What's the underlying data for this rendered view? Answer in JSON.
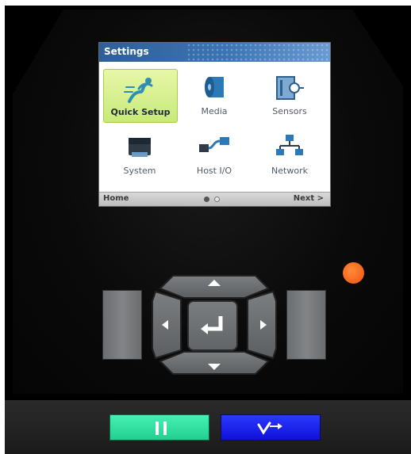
{
  "screen": {
    "title": "Settings",
    "header_color": "#3b74b4",
    "tiles": [
      {
        "label": "Quick Setup",
        "icon": "quick-setup-icon",
        "selected": true
      },
      {
        "label": "Media",
        "icon": "media-roll-icon",
        "selected": false
      },
      {
        "label": "Sensors",
        "icon": "sensors-icon",
        "selected": false
      },
      {
        "label": "System",
        "icon": "printer-icon",
        "selected": false
      },
      {
        "label": "Host I/O",
        "icon": "host-io-cable-icon",
        "selected": false
      },
      {
        "label": "Network",
        "icon": "network-icon",
        "selected": false
      }
    ],
    "footer": {
      "home_label": "Home",
      "next_label": "Next >",
      "page_current": 1,
      "page_total": 2
    }
  },
  "indicators": {
    "status_led_color": "#f0520b"
  },
  "keypad": {
    "up_icon": "arrow-up-icon",
    "down_icon": "arrow-down-icon",
    "left_icon": "arrow-left-icon",
    "right_icon": "arrow-right-icon",
    "ok_icon": "enter-icon"
  },
  "buttons": {
    "pause_icon": "pause-icon",
    "pause_color": "#20d08f",
    "feed_icon": "feed-icon",
    "feed_color": "#1010d8"
  }
}
